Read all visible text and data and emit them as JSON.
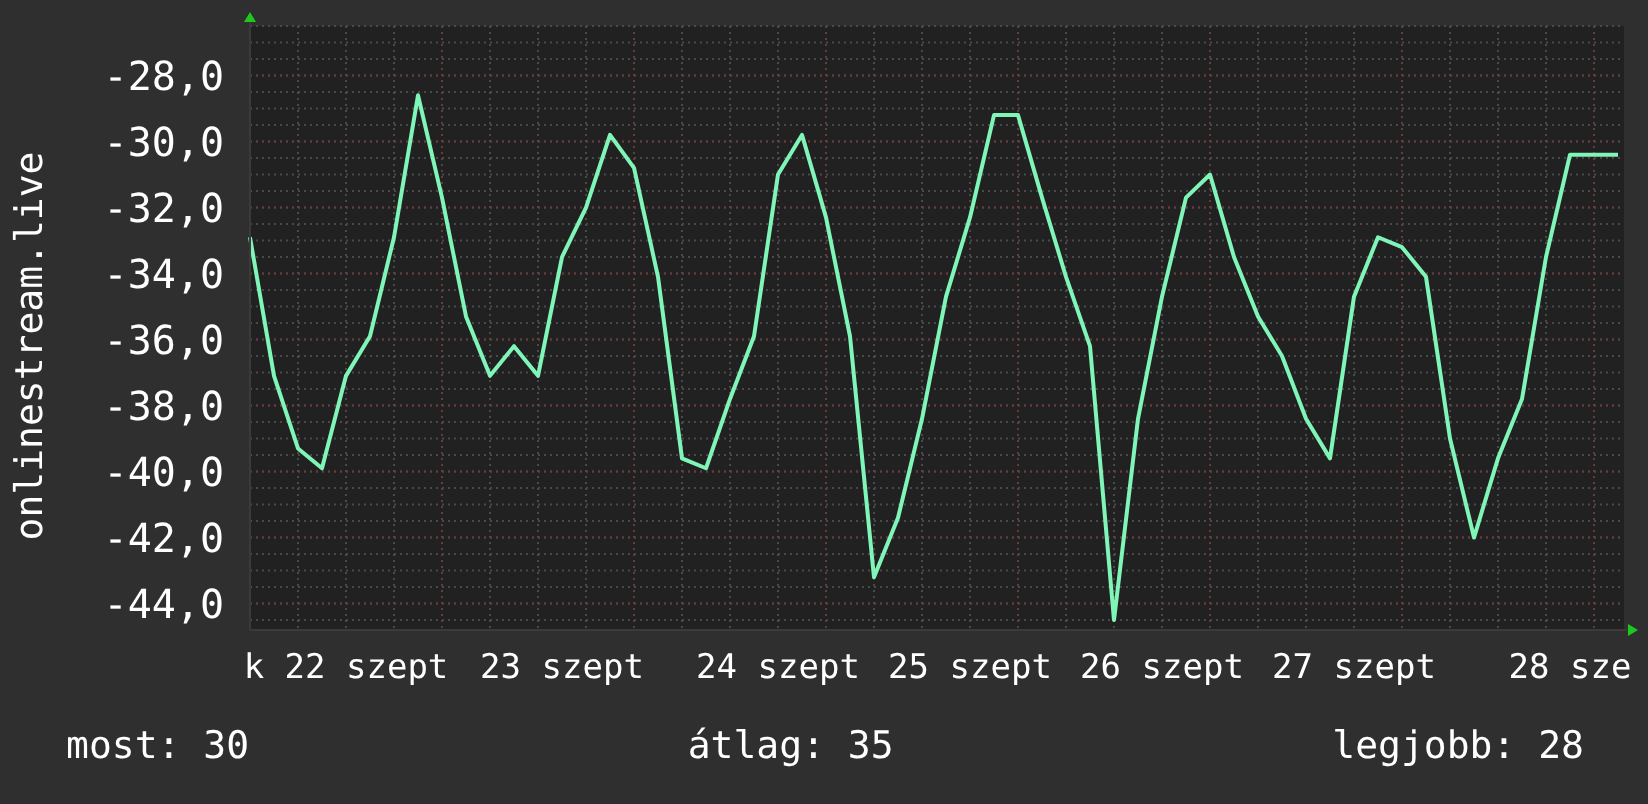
{
  "chart": {
    "chart_data": {
      "type": "line",
      "ylabel": "onlinestream.live",
      "grid": true,
      "ylim": [
        -44.8,
        -26.5
      ],
      "categories": [
        null,
        null,
        null,
        null,
        "k 22 szept",
        null,
        null,
        null,
        null,
        null,
        null,
        null,
        null,
        "23 szept",
        null,
        null,
        null,
        null,
        null,
        null,
        null,
        null,
        "24 szept",
        null,
        null,
        null,
        null,
        null,
        null,
        null,
        "25 szept",
        null,
        null,
        null,
        null,
        null,
        null,
        null,
        "26 szept",
        null,
        null,
        null,
        null,
        null,
        null,
        null,
        "27 szept",
        null,
        null,
        null,
        null,
        null,
        null,
        null,
        null,
        "28 sze",
        null,
        null
      ],
      "series": [
        {
          "color": "#80f5b8",
          "values": [
            -32.9,
            -37.1,
            -39.3,
            -39.9,
            -37.1,
            -35.9,
            -32.9,
            -28.6,
            -31.7,
            -35.3,
            -37.1,
            -36.2,
            -37.1,
            -33.5,
            -32,
            -29.8,
            -30.8,
            -34.1,
            -39.6,
            -39.9,
            -37.8,
            -35.9,
            -31,
            -29.8,
            -32.3,
            -35.9,
            -43.2,
            -41.4,
            -38.4,
            -34.7,
            -32.3,
            -29.2,
            -29.2,
            -31.7,
            -34.1,
            -36.2,
            -44.5,
            -38.4,
            -34.7,
            -31.7,
            -31,
            -33.5,
            -35.3,
            -36.5,
            -38.4,
            -39.6,
            -34.7,
            -32.9,
            -33.2,
            -34.1,
            -39,
            -42,
            -39.6,
            -37.8,
            -33.5,
            -30.4,
            -30.4,
            -30.4
          ]
        }
      ],
      "yticks": [
        {
          "value": -28,
          "label": "-28,0"
        },
        {
          "value": -30,
          "label": "-30,0"
        },
        {
          "value": -32,
          "label": "-32,0"
        },
        {
          "value": -34,
          "label": "-34,0"
        },
        {
          "value": -36,
          "label": "-36,0"
        },
        {
          "value": -38,
          "label": "-38,0"
        },
        {
          "value": -40,
          "label": "-40,0"
        },
        {
          "value": -42,
          "label": "-42,0"
        },
        {
          "value": -44,
          "label": "-44,0"
        }
      ]
    }
  },
  "legend": [
    "most: 30",
    "átlag: 35",
    "legjobb: 28"
  ]
}
